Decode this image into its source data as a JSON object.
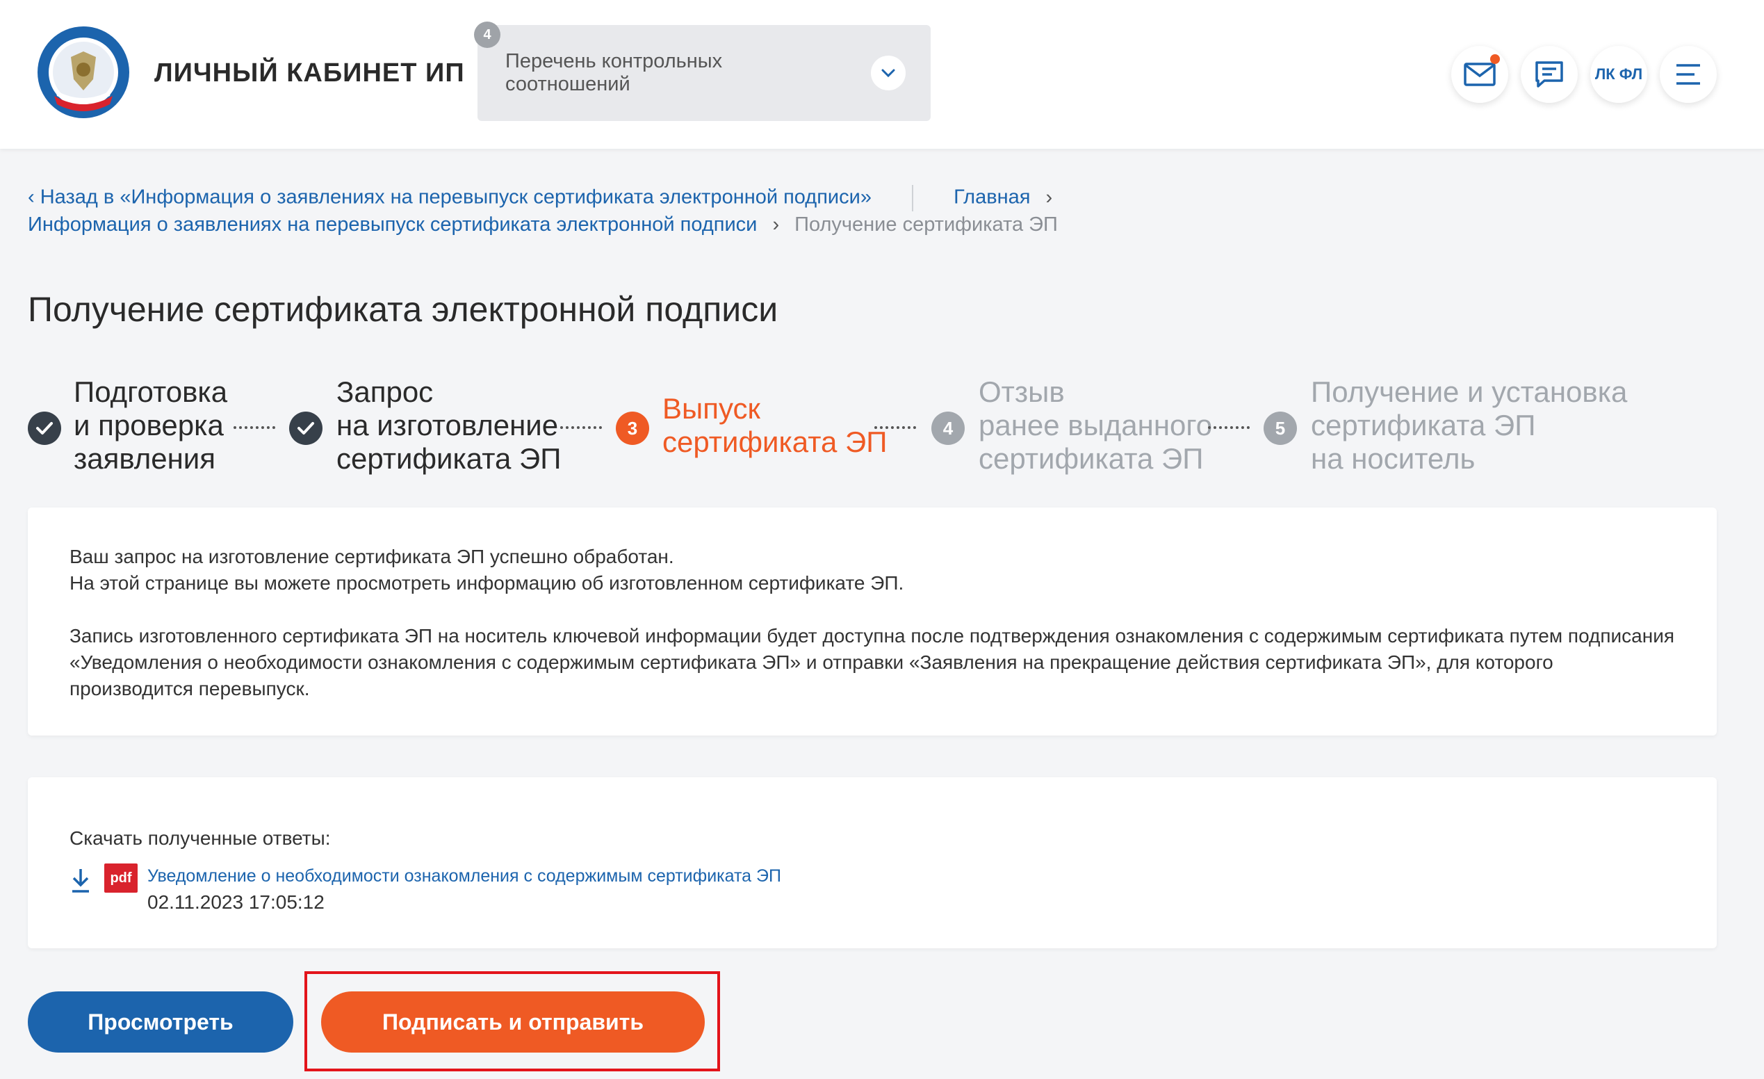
{
  "header": {
    "brand_title": "ЛИЧНЫЙ КАБИНЕТ ИП",
    "dropdown": {
      "badge": "4",
      "text": "Перечень контрольных соотношений"
    },
    "buttons": {
      "lk_label": "ЛК ФЛ"
    },
    "icons": [
      "mail-icon",
      "chat-icon",
      "menu-icon"
    ],
    "notification_color": "#ef5a24"
  },
  "breadcrumb": {
    "back": "Назад в «Информация о заявлениях на перевыпуск сертификата электронной подписи»",
    "home": "Главная",
    "parent": "Информация о заявлениях на перевыпуск сертификата электронной подписи",
    "current": "Получение сертификата ЭП"
  },
  "page_title": "Получение сертификата электронной подписи",
  "steps": [
    {
      "number": "1",
      "label": "Подготовка\nи проверка\nзаявления",
      "state": "done"
    },
    {
      "number": "2",
      "label": "Запрос\nна изготовление\nсертификата ЭП",
      "state": "done"
    },
    {
      "number": "3",
      "label": "Выпуск\nсертификата ЭП",
      "state": "active"
    },
    {
      "number": "4",
      "label": "Отзыв\nранее выданного\nсертификата ЭП",
      "state": "pending"
    },
    {
      "number": "5",
      "label": "Получение и установка\nсертификата ЭП\nна носитель",
      "state": "pending"
    }
  ],
  "info": {
    "line1": "Ваш запрос на изготовление сертификата ЭП успешно обработан.",
    "line2": "На этой странице вы можете просмотреть информацию об изготовленном сертификате ЭП.",
    "line3": "Запись изготовленного сертификата ЭП на носитель ключевой информации будет доступна после подтверждения ознакомления с содержимым сертификата путем подписания «Уведомления о необходимости ознакомления с содержимым сертификата ЭП» и отправки «Заявления на прекращение действия сертификата ЭП», для которого производится перевыпуск."
  },
  "downloads": {
    "label": "Скачать полученные ответы:",
    "file_type": "pdf",
    "file_name": "Уведомление о необходимости ознакомления с содержимым сертификата ЭП",
    "file_date": "02.11.2023 17:05:12"
  },
  "actions": {
    "view": "Просмотреть",
    "sign": "Подписать и отправить"
  },
  "colors": {
    "primary": "#1c64ad",
    "accent": "#ef5a24",
    "done": "#37404a",
    "pending": "#a2a7ad",
    "highlight": "#e3141b"
  }
}
